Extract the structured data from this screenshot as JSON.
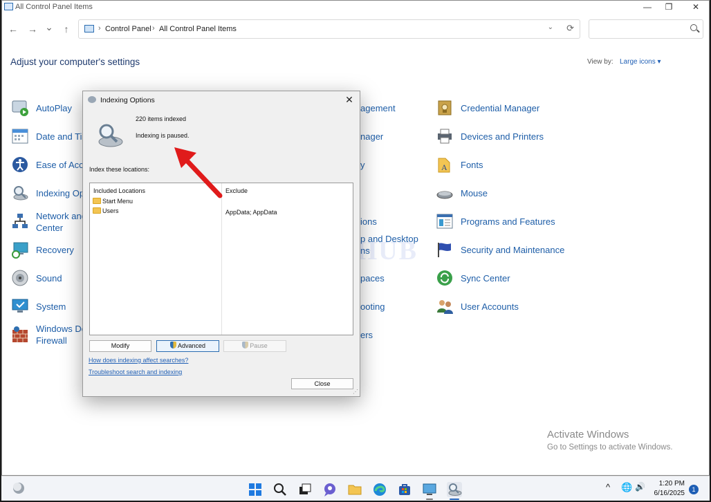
{
  "window": {
    "title": "All Control Panel Items",
    "controls": {
      "minimize": "—",
      "maximize": "❐",
      "close": "✕"
    }
  },
  "nav": {
    "back": "←",
    "forward": "→",
    "recent": "⌄",
    "up": "↑",
    "breadcrumbs": [
      "Control Panel",
      "All Control Panel Items"
    ],
    "separator": "›",
    "dropdown": "⌄",
    "refresh": "⟳"
  },
  "header": {
    "title": "Adjust your computer's settings",
    "view_by_label": "View by:",
    "view_by_value": "Large icons ▾"
  },
  "items": {
    "col1": [
      {
        "label": "AutoPlay",
        "icon": "autoplay-icon"
      },
      {
        "label": "Date and Ti",
        "icon": "calendar-icon"
      },
      {
        "label": "Ease of Acce",
        "icon": "ease-of-access-icon"
      },
      {
        "label": "Indexing Op",
        "icon": "indexing-icon"
      },
      {
        "label": "Network and",
        "label2": "Center",
        "icon": "network-icon"
      },
      {
        "label": "Recovery",
        "icon": "recovery-icon"
      },
      {
        "label": "Sound",
        "icon": "speaker-icon"
      },
      {
        "label": "System",
        "icon": "system-icon"
      },
      {
        "label": "Windows De",
        "label2": "Firewall",
        "icon": "firewall-icon"
      }
    ],
    "col2": [
      {
        "label": "agement"
      },
      {
        "label": "nager"
      },
      {
        "label": "y"
      },
      {
        "label": "ions"
      },
      {
        "label": "p and Desktop",
        "label2": "ns"
      },
      {
        "label": "paces"
      },
      {
        "label": "ooting"
      },
      {
        "label": "ers"
      }
    ],
    "col3": [
      {
        "label": "Credential Manager",
        "icon": "credential-icon"
      },
      {
        "label": "Devices and Printers",
        "icon": "printer-icon"
      },
      {
        "label": "Fonts",
        "icon": "fonts-icon"
      },
      {
        "label": "Mouse",
        "icon": "mouse-icon"
      },
      {
        "label": "Programs and Features",
        "icon": "programs-icon"
      },
      {
        "label": "Security and Maintenance",
        "icon": "flag-icon"
      },
      {
        "label": "Sync Center",
        "icon": "sync-icon"
      },
      {
        "label": "User Accounts",
        "icon": "users-icon"
      }
    ]
  },
  "watermark": "IT Pros HUB",
  "dialog": {
    "title": "Indexing Options",
    "close": "✕",
    "count": "220 items indexed",
    "status": "Indexing is paused.",
    "locations_label": "Index these locations:",
    "col_included": "Included Locations",
    "col_exclude": "Exclude",
    "locations": [
      "Start Menu",
      "Users"
    ],
    "exclude_value": "AppData; AppData",
    "buttons": {
      "modify": "Modify",
      "advanced": "Advanced",
      "pause": "Pause",
      "close": "Close"
    },
    "links": [
      "How does indexing affect searches?",
      "Troubleshoot search and indexing"
    ]
  },
  "activation": {
    "title": "Activate Windows",
    "subtitle": "Go to Settings to activate Windows."
  },
  "taskbar": {
    "time": "1:20 PM",
    "date": "6/16/2025",
    "notification_count": "1",
    "tray_chevron": "^",
    "volume": "🔊",
    "network": "🌐"
  },
  "colors": {
    "link": "#1e5ea8",
    "arrow": "#e01b1b",
    "heading": "#1e3a6e"
  }
}
